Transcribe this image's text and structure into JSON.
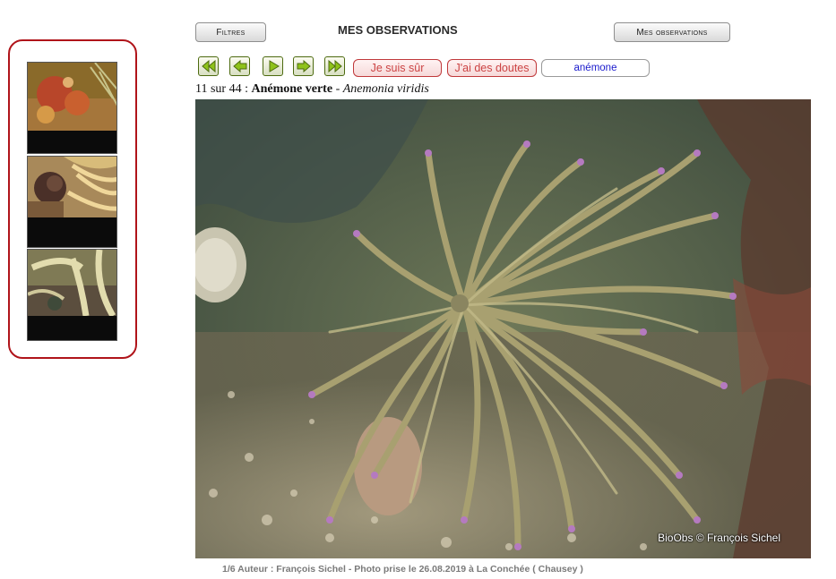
{
  "header": {
    "filters_label": "Filtres",
    "title": "MES OBSERVATIONS",
    "my_observations_label": "Mes observations"
  },
  "navigation": {
    "first_icon": "double-arrow-left-icon",
    "prev_icon": "arrow-left-icon",
    "play_icon": "play-icon",
    "next_icon": "arrow-right-icon",
    "last_icon": "double-arrow-right-icon",
    "sure_label": "Je suis sûr",
    "doubt_label": "J'ai des doutes",
    "search_value": "anémone"
  },
  "observation": {
    "counter_text": "11 sur 44 : ",
    "common_name": "Anémone verte",
    "separator": " - ",
    "scientific_name": "Anemonia viridis",
    "photo_credit": "BioObs © François Sichel",
    "caption": "1/6  Auteur : François Sichel - Photo prise le 26.08.2019 à La Conchée ( Chausey )"
  },
  "thumbnails": [
    {
      "name": "thumbnail-1"
    },
    {
      "name": "thumbnail-2"
    },
    {
      "name": "thumbnail-3"
    }
  ],
  "colors": {
    "panel_border": "#b0141a",
    "nav_arrow": "#8ec21a",
    "sure_text": "#cc4444",
    "search_text": "#1a1acc"
  }
}
